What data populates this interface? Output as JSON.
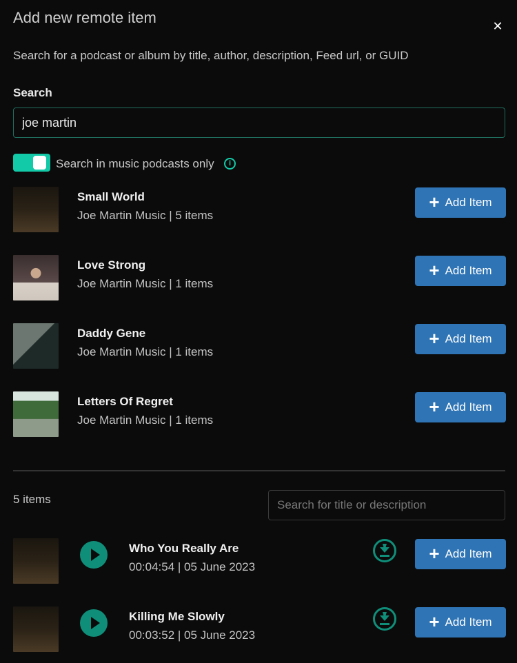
{
  "dialog": {
    "title": "Add new remote item",
    "close_icon": "close-icon",
    "subtitle": "Search for a podcast or album by title, author, description, Feed url, or GUID"
  },
  "search": {
    "label": "Search",
    "value": "joe martin",
    "toggle_label": "Search in music podcasts only",
    "toggle_on": true
  },
  "colors": {
    "accent": "#12c9a8",
    "button": "#2f74b5",
    "play": "#0f8f7a",
    "background": "#0b0b0b"
  },
  "results": [
    {
      "title": "Small World",
      "subtitle": "Joe Martin Music | 5 items",
      "button": "Add Item"
    },
    {
      "title": "Love Strong",
      "subtitle": "Joe Martin Music | 1 items",
      "button": "Add Item"
    },
    {
      "title": "Daddy Gene",
      "subtitle": "Joe Martin Music | 1 items",
      "button": "Add Item"
    },
    {
      "title": "Letters Of Regret",
      "subtitle": "Joe Martin Music | 1 items",
      "button": "Add Item"
    }
  ],
  "episodes_panel": {
    "count": "5 items",
    "filter_placeholder": "Search for title or description"
  },
  "episodes": [
    {
      "title": "Who You Really Are",
      "meta": "00:04:54 | 05 June 2023",
      "button": "Add Item"
    },
    {
      "title": "Killing Me Slowly",
      "meta": "00:03:52 | 05 June 2023",
      "button": "Add Item"
    }
  ]
}
